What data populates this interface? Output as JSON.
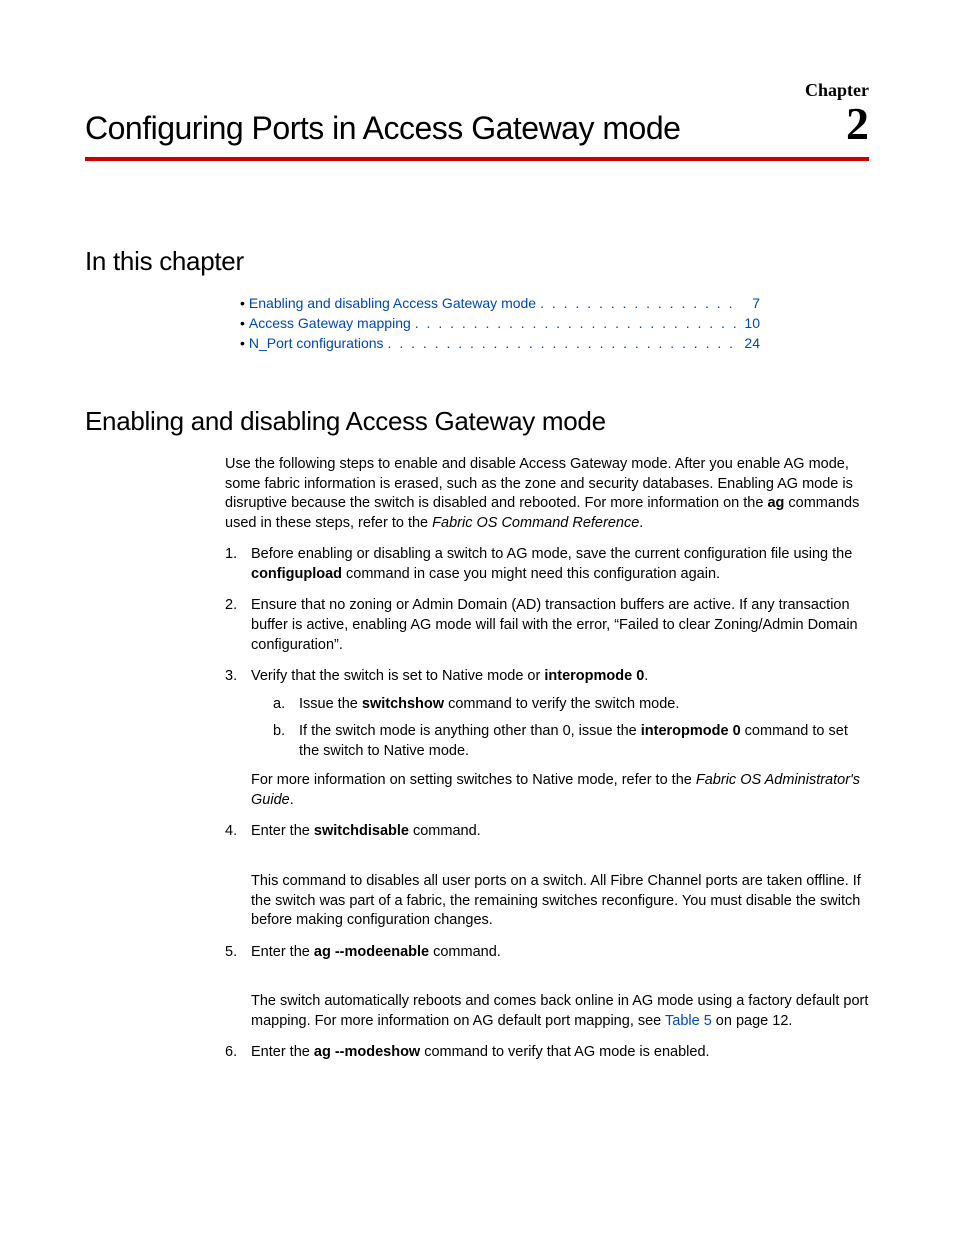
{
  "header": {
    "chapter_word": "Chapter",
    "chapter_number": "2",
    "chapter_title": "Configuring Ports in Access Gateway mode"
  },
  "toc_heading": "In this chapter",
  "toc": [
    {
      "label": "Enabling and disabling Access Gateway mode",
      "page": "7"
    },
    {
      "label": "Access Gateway mapping",
      "page": "10"
    },
    {
      "label": "N_Port configurations",
      "page": "24"
    }
  ],
  "section_heading": "Enabling and disabling Access Gateway mode",
  "intro": {
    "t1": "Use the following steps to enable and disable Access Gateway mode. After you enable AG mode, some fabric information is erased, such as the zone and security databases. Enabling AG mode is disruptive because the switch is disabled and rebooted. For more information on the ",
    "b1": "ag",
    "t2": " commands used in these steps, refer to the ",
    "i1": "Fabric OS Command Reference",
    "t3": "."
  },
  "steps": {
    "s1": {
      "num": "1.",
      "t1": "Before enabling or disabling a switch to AG mode, save the current configuration file using the ",
      "b1": "configupload",
      "t2": " command in case you might need this configuration again."
    },
    "s2": {
      "num": "2.",
      "t1": "Ensure that no zoning or Admin Domain (AD) transaction buffers are active. If any transaction buffer is active, enabling AG mode will fail with the error, “Failed to clear Zoning/Admin Domain configuration”."
    },
    "s3": {
      "num": "3.",
      "t1": "Verify that the switch is set to Native mode or ",
      "b1": "interopmode 0",
      "t2": ".",
      "a": {
        "num": "a.",
        "t1": "Issue the ",
        "b1": "switchshow",
        "t2": " command to verify the switch mode."
      },
      "b": {
        "num": "b.",
        "t1": "If the switch mode is anything other than 0, issue the ",
        "b1": "interopmode 0",
        "t2": " command to set the switch to Native mode."
      },
      "note_t1": "For more information on setting switches to Native mode, refer to the ",
      "note_i1": "Fabric OS Administrator's Guide",
      "note_t2": "."
    },
    "s4": {
      "num": "4.",
      "t1": "Enter the ",
      "b1": "switchdisable",
      "t2": " command.",
      "desc": "This command to disables all user ports on a switch. All Fibre Channel ports are taken offline. If the switch was part of a fabric, the remaining switches reconfigure. You must disable the switch before making configuration changes."
    },
    "s5": {
      "num": "5.",
      "t1": "Enter the ",
      "b1": "ag ‑‑modeenable",
      "t2": " command.",
      "desc_t1": "The switch automatically reboots and comes back online in AG mode using a factory default port mapping. For more information on AG default port mapping, see ",
      "desc_l1": "Table 5",
      "desc_t2": " on page 12."
    },
    "s6": {
      "num": "6.",
      "t1": "Enter the ",
      "b1": "ag ‑‑modeshow",
      "t2": " command to verify that AG mode is enabled."
    }
  }
}
